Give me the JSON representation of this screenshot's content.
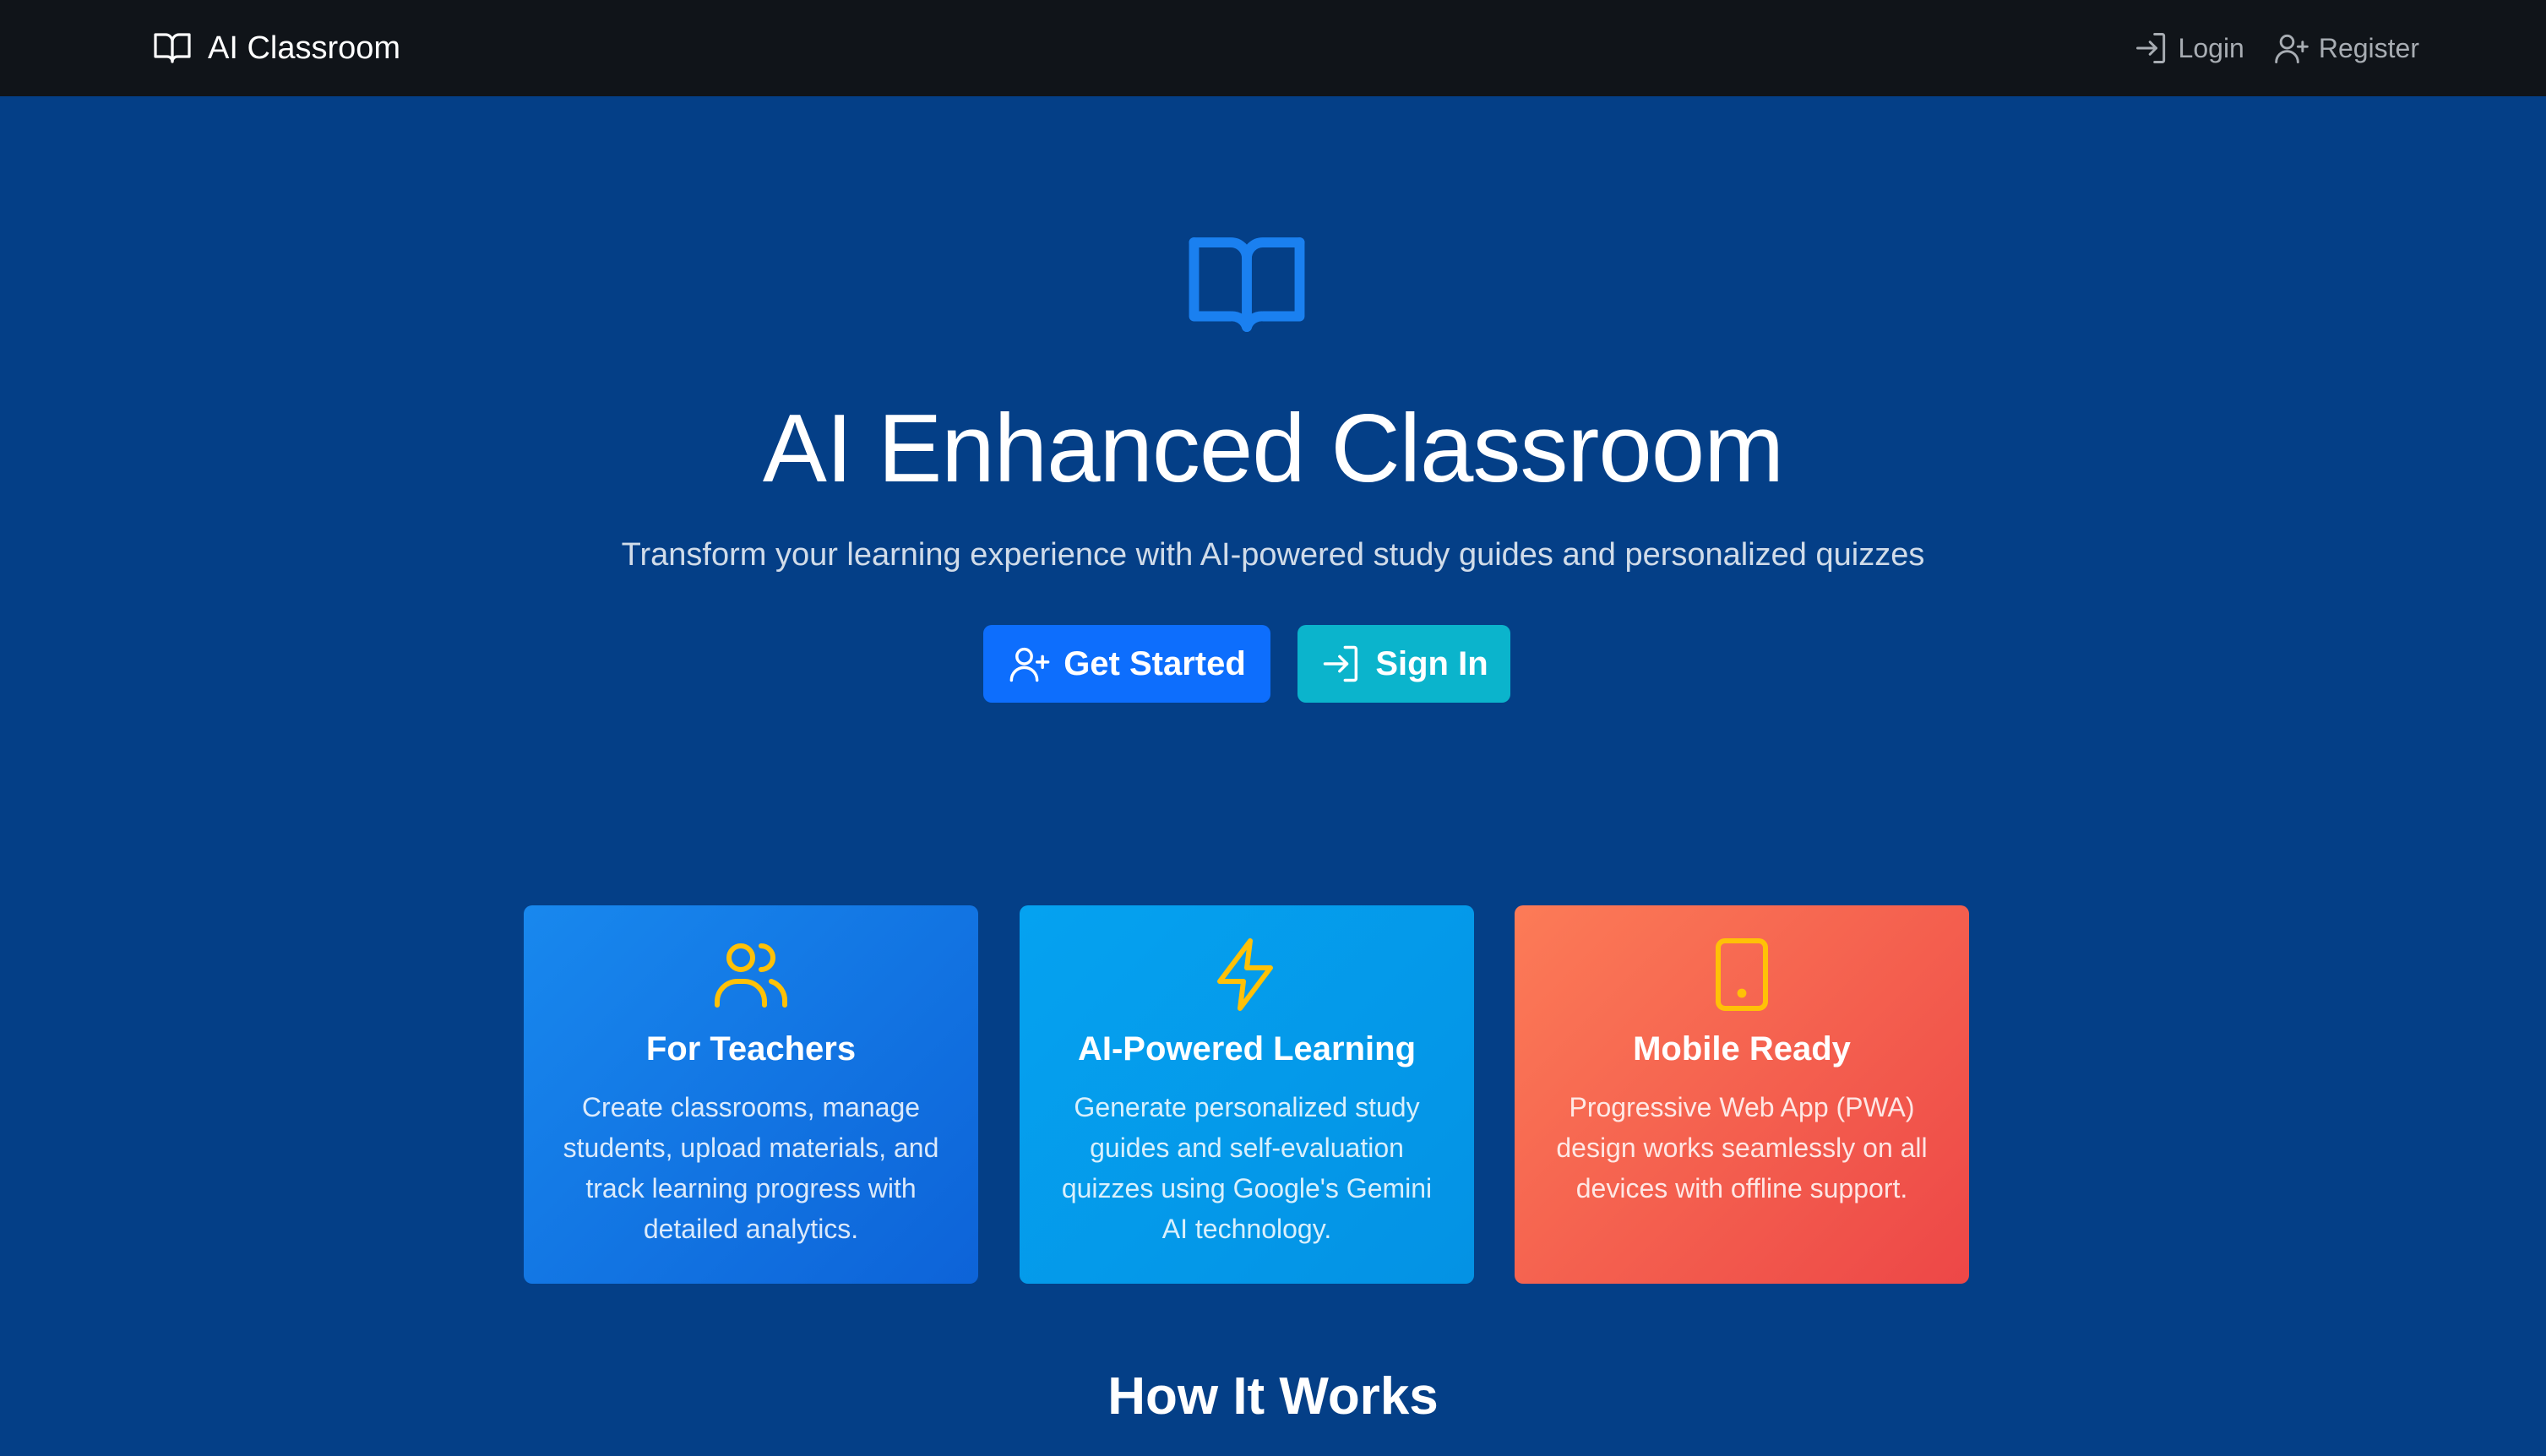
{
  "navbar": {
    "brand": "AI Classroom",
    "login_label": "Login",
    "register_label": "Register"
  },
  "hero": {
    "title": "AI Enhanced Classroom",
    "subtitle": "Transform your learning experience with AI-powered study guides and personalized quizzes",
    "get_started_label": "Get Started",
    "sign_in_label": "Sign In"
  },
  "features": [
    {
      "icon": "people-icon",
      "title": "For Teachers",
      "description": "Create classrooms, manage students, upload materials, and track learning progress with detailed analytics."
    },
    {
      "icon": "lightning-icon",
      "title": "AI-Powered Learning",
      "description": "Generate personalized study guides and self-evaluation quizzes using Google's Gemini AI technology."
    },
    {
      "icon": "tablet-icon",
      "title": "Mobile Ready",
      "description": "Progressive Web App (PWA) design works seamlessly on all devices with offline support."
    }
  ],
  "how_it_works": {
    "title": "How It Works"
  },
  "colors": {
    "navbar_bg": "#101419",
    "page_bg": "#043f87",
    "primary": "#0d6efd",
    "info": "#0bb4cc",
    "accent_yellow": "#ffc107",
    "hero_icon_blue": "#1a80f0"
  }
}
